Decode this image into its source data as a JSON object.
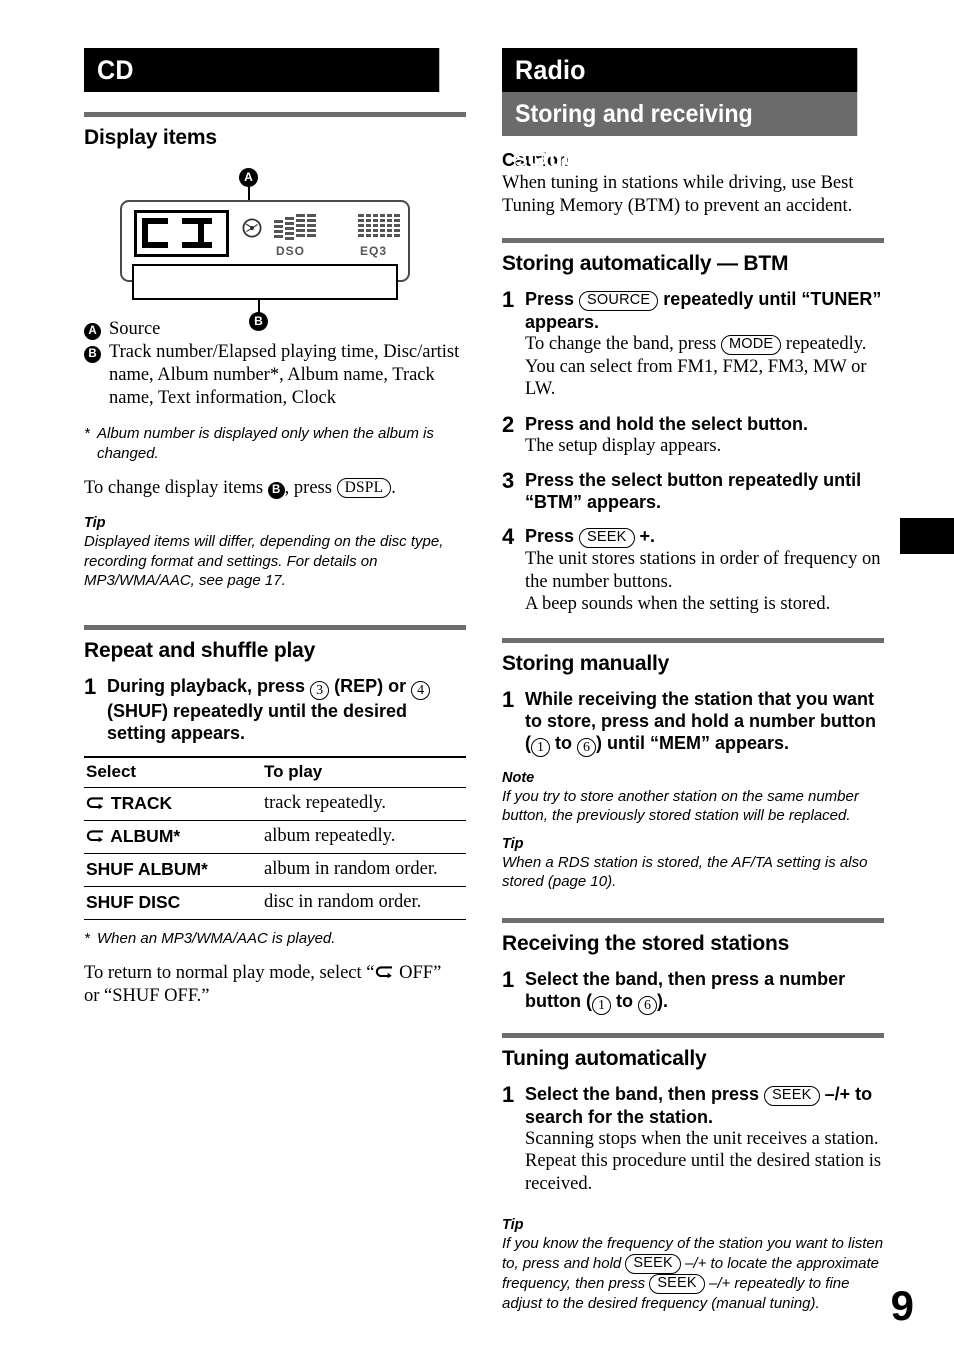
{
  "page_number": "9",
  "left_column": {
    "banner": "CD",
    "section_display_items": {
      "heading": "Display items",
      "figure": {
        "callout_a": "A",
        "callout_b": "B",
        "source_text": "CD",
        "indicator_dso": "DSO",
        "indicator_eq3": "EQ3",
        "disc_icon_name": "disc-icon"
      },
      "legend": [
        {
          "key": "A",
          "value": "Source"
        },
        {
          "key": "B",
          "value": "Track number/Elapsed playing time, Disc/artist name, Album number*, Album name, Track name, Text information, Clock"
        }
      ],
      "footnote": "Album number is displayed only when the album is changed.",
      "change_items_before": "To change display items ",
      "change_items_mid": ", press ",
      "change_items_button": "DSPL",
      "change_items_after": ".",
      "tip_label": "Tip",
      "tip_text": "Displayed items will differ, depending on the disc type, recording format and settings. For details on MP3/WMA/AAC, see page 17."
    },
    "section_repeat": {
      "heading": "Repeat and shuffle play",
      "step1": {
        "number": "1",
        "part1": "During playback, press ",
        "btn_rep": "3",
        "part2": " (REP) or ",
        "btn_shuf": "4",
        "part3": " (SHUF) repeatedly until the desired setting appears."
      },
      "table": {
        "headers": [
          "Select",
          "To play"
        ],
        "rows": [
          {
            "icon": "repeat-icon",
            "select": "TRACK",
            "asterisk": "",
            "play": "track repeatedly."
          },
          {
            "icon": "repeat-icon",
            "select": "ALBUM",
            "asterisk": "*",
            "play": "album repeatedly."
          },
          {
            "icon": "",
            "select": "SHUF ALBUM",
            "asterisk": "*",
            "play": "album in random order."
          },
          {
            "icon": "",
            "select": "SHUF DISC",
            "asterisk": "",
            "play": "disc in random order."
          }
        ]
      },
      "table_footnote": "When an MP3/WMA/AAC is played.",
      "return_text_before": "To return to normal play mode, select “",
      "return_text_mid": " OFF”",
      "return_text_after": "or “SHUF OFF.”"
    }
  },
  "right_column": {
    "banner_black": "Radio",
    "banner_gray": "Storing and receiving stations",
    "caution": {
      "label": "Caution",
      "text": "When tuning in stations while driving, use Best Tuning Memory (BTM) to prevent an accident."
    },
    "section_btm": {
      "heading": "Storing automatically — BTM",
      "steps": [
        {
          "number": "1",
          "title_before": "Press ",
          "title_button": "SOURCE",
          "title_after": " repeatedly until “TUNER” appears.",
          "desc_before": "To change the band, press ",
          "desc_button": "MODE",
          "desc_after": " repeatedly. You can select from FM1, FM2, FM3, MW or LW."
        },
        {
          "number": "2",
          "title": "Press and hold the select button.",
          "desc": "The setup display appears."
        },
        {
          "number": "3",
          "title": "Press the select button repeatedly until “BTM” appears.",
          "desc": ""
        },
        {
          "number": "4",
          "title_before": "Press ",
          "title_button": "SEEK",
          "title_after": " +.",
          "desc": "The unit stores stations in order of frequency on the number buttons.",
          "desc2": "A beep sounds when the setting is stored."
        }
      ]
    },
    "section_manual": {
      "heading": "Storing manually",
      "step1": {
        "number": "1",
        "part1": "While receiving the station that you want to store, press and hold a number button (",
        "btn_from": "1",
        "part2": " to ",
        "btn_to": "6",
        "part3": ") until “MEM” appears."
      },
      "note_label": "Note",
      "note_text": "If you try to store another station on the same number button, the previously stored station will be replaced.",
      "tip_label": "Tip",
      "tip_text": "When a RDS station is stored, the AF/TA setting is also stored (page 10)."
    },
    "section_receiving": {
      "heading": "Receiving the stored stations",
      "step1": {
        "number": "1",
        "part1": "Select the band, then press a number button (",
        "btn_from": "1",
        "part2": " to ",
        "btn_to": "6",
        "part3": ")."
      }
    },
    "section_tuning": {
      "heading": "Tuning automatically",
      "step1": {
        "number": "1",
        "part1": "Select the band, then press ",
        "btn": "SEEK",
        "part2": " –/+ to search for the station.",
        "desc": "Scanning stops when the unit receives a station. Repeat this procedure until the desired station is received."
      },
      "tip_label": "Tip",
      "tip_1": "If you know the frequency of the station you want to listen to, press and hold ",
      "tip_btn1": "SEEK",
      "tip_2": " –/+ to locate the approximate frequency, then press ",
      "tip_btn2": "SEEK",
      "tip_3": " –/+ repeatedly to fine adjust to the desired frequency (manual tuning)."
    }
  }
}
